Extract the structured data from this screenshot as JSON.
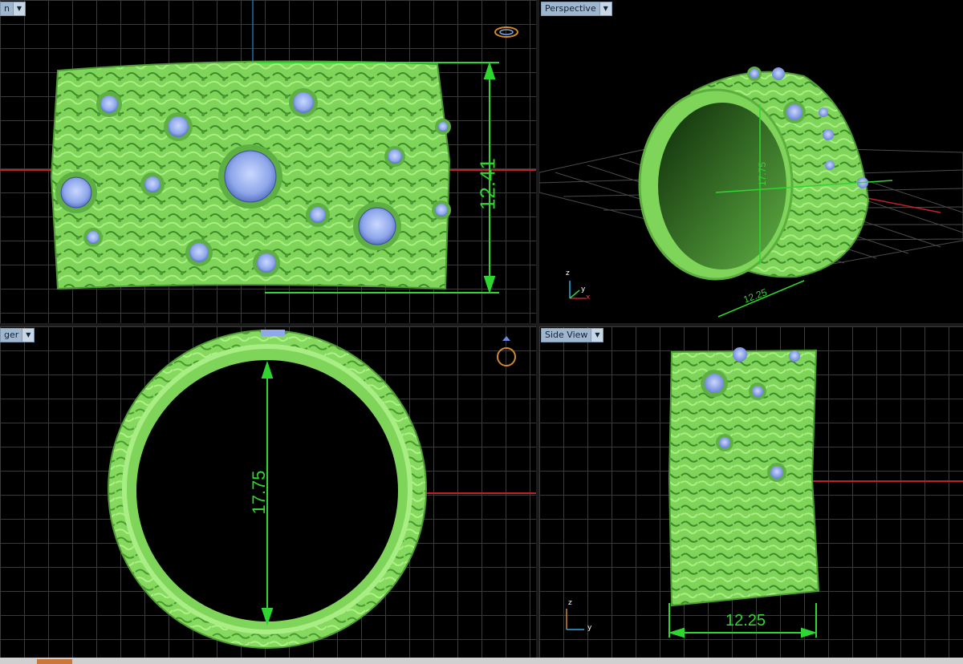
{
  "viewports": {
    "top_left": {
      "tab_label": "n",
      "dimension": "12.41"
    },
    "top_right": {
      "tab_label": "Perspective",
      "dimension_height": "17.75",
      "dimension_width": "12.25",
      "axis_z": "z",
      "axis_y": "y",
      "axis_x": "x"
    },
    "bottom_left": {
      "tab_label": "ger",
      "dimension": "17.75"
    },
    "bottom_right": {
      "tab_label": "Side View",
      "dimension": "12.25",
      "axis_z": "z",
      "axis_y": "y"
    }
  },
  "colors": {
    "model": "#7fd45a",
    "stone": "#8fa9e8",
    "dimension": "#2fd62f",
    "grid": "#3a3a3a",
    "axis_red": "#c0202a"
  }
}
